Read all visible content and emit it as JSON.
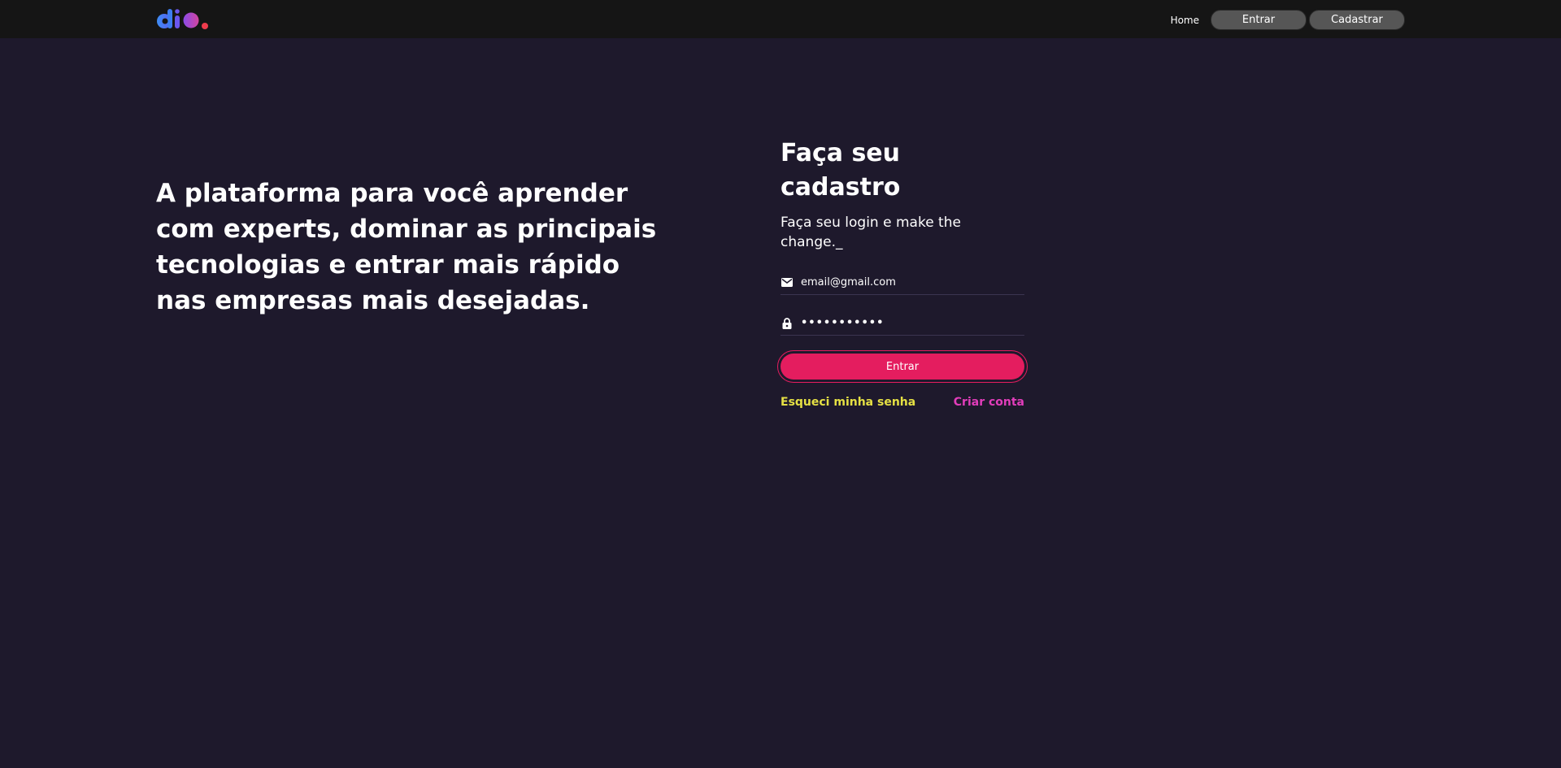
{
  "header": {
    "logo_alt": "dio.",
    "nav": {
      "home_label": "Home",
      "login_label": "Entrar",
      "signup_label": "Cadastrar"
    }
  },
  "hero": {
    "text": "A plataforma para você aprender com experts, dominar as principais tecnologias e entrar mais rápido nas empresas mais desejadas."
  },
  "form": {
    "title": "Faça seu cadastro",
    "subtitle": "Faça seu login e make the change._",
    "email": {
      "icon": "mail-icon",
      "placeholder": "email@gmail.com",
      "value": ""
    },
    "password": {
      "icon": "lock-icon",
      "value": "•••••••••••"
    },
    "submit_label": "Entrar",
    "forgot_label": "Esqueci minha senha",
    "create_label": "Criar conta"
  },
  "colors": {
    "background": "#1e192c",
    "header": "#151515",
    "accent": "#e41d5f",
    "forgot": "#e5e044",
    "create": "#e23dbb"
  }
}
